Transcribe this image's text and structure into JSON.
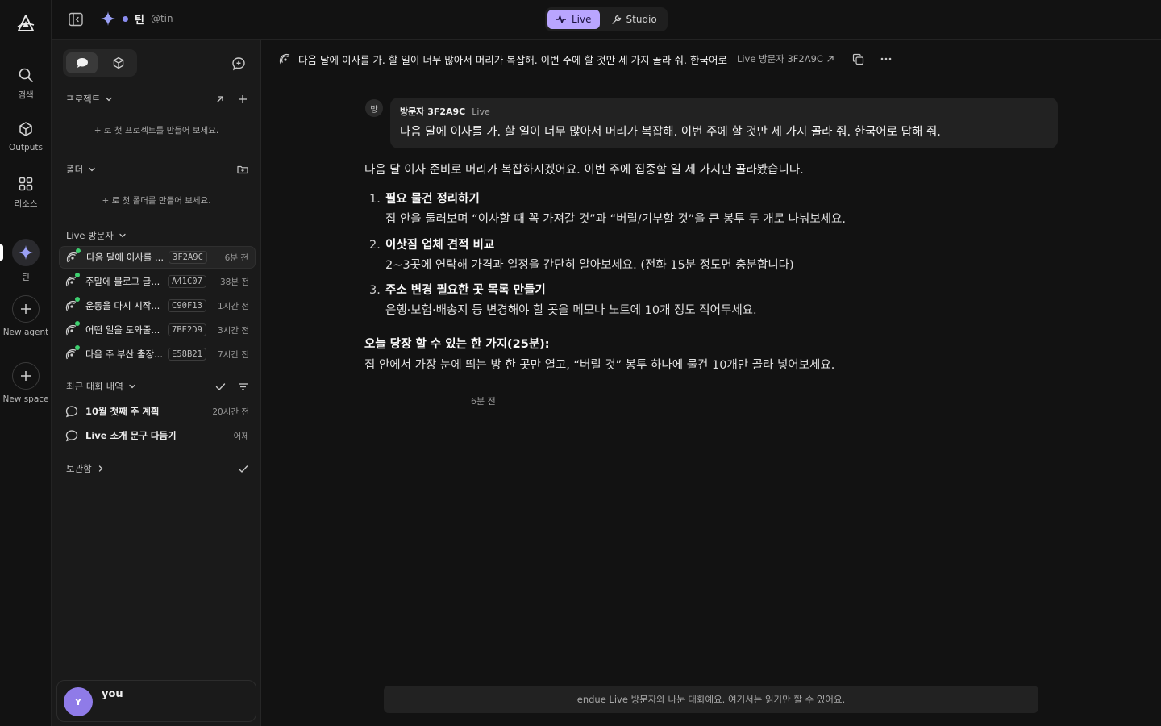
{
  "rail": {
    "items": [
      {
        "label": "검색",
        "icon": "search-icon"
      },
      {
        "label": "Outputs",
        "icon": "cube-icon"
      },
      {
        "label": "리소스",
        "icon": "grid-icon"
      },
      {
        "label": "틴",
        "icon": "diamond-icon"
      },
      {
        "label": "New agent",
        "icon": "plus-icon"
      },
      {
        "label": "New space",
        "icon": "plus-icon"
      }
    ]
  },
  "topbar": {
    "agent_name": "틴",
    "agent_handle": "@tin",
    "modes": [
      {
        "label": "Live",
        "active": true
      },
      {
        "label": "Studio",
        "active": false
      }
    ]
  },
  "sidebar": {
    "projects": {
      "title": "프로젝트",
      "empty_hint": "+ 로 첫 프로젝트를 만들어 보세요."
    },
    "folders": {
      "title": "폴더",
      "empty_hint": "+ 로 첫 폴더를 만들어 보세요."
    },
    "live": {
      "title": "Live 방문자",
      "items": [
        {
          "title": "다음 달에 이사를 ...",
          "code": "3F2A9C",
          "time": "6분 전",
          "active": true
        },
        {
          "title": "주말에 블로그 글...",
          "code": "A41C07",
          "time": "38분 전",
          "active": false
        },
        {
          "title": "운동을 다시 시작...",
          "code": "C90F13",
          "time": "1시간 전",
          "active": false
        },
        {
          "title": "어떤 일을 도와줄...",
          "code": "7BE2D9",
          "time": "3시간 전",
          "active": false
        },
        {
          "title": "다음 주 부산 출장...",
          "code": "E58B21",
          "time": "7시간 전",
          "active": false
        }
      ]
    },
    "history": {
      "title": "최근 대화 내역",
      "items": [
        {
          "title": "10월 첫째 주 계획",
          "time": "20시간 전"
        },
        {
          "title": "Live 소개 문구 다듬기",
          "time": "어제"
        }
      ]
    },
    "archive": {
      "title": "보관함"
    },
    "user": {
      "initial": "Y",
      "name": "you"
    }
  },
  "conversation": {
    "title": "다음 달에 이사를 가. 할 일이 너무 많아서 머리가 복잡해. 이번 주에 할 것만 세 가지 골라 줘. 한국어로",
    "visitor": "Live 방문자 3F2A9C",
    "user_message": {
      "avatar": "방",
      "name": "방문자 3F2A9C",
      "tag": "Live",
      "text": "다음 달에 이사를 가. 할 일이 너무 많아서 머리가 복잡해. 이번 주에 할 것만 세 가지 골라 줘. 한국어로 답해 줘."
    },
    "answer": {
      "intro": "다음 달 이사 준비로 머리가 복잡하시겠어요. 이번 주에 집중할 일 세 가지만 골라봤습니다.",
      "steps": [
        {
          "num": "1.",
          "title": "필요 물건 정리하기",
          "desc": "집 안을 둘러보며 “이사할 때 꼭 가져갈 것”과 “버릴/기부할 것”을 큰 봉투 두 개로 나눠보세요."
        },
        {
          "num": "2.",
          "title": "이삿짐 업체 견적 비교",
          "desc": "2~3곳에 연락해 가격과 일정을 간단히 알아보세요. (전화 15분 정도면 충분합니다)"
        },
        {
          "num": "3.",
          "title": "주소 변경 필요한 곳 목록 만들기",
          "desc": "은행·보험·배송지 등 변경해야 할 곳을 메모나 노트에 10개 정도 적어두세요."
        }
      ],
      "today_title": "오늘 당장 할 수 있는 한 가지(25분):",
      "today_desc": "집 안에서 가장 눈에 띄는 방 한 곳만 열고, “버릴 것” 봉투 하나에 물건 10개만 골라 넣어보세요.",
      "time": "6분 전"
    },
    "readonly_notice": "endue Live 방문자와 나눈 대화예요. 여기서는 읽기만 할 수 있어요."
  },
  "colors": {
    "accent": "#b9a5ff",
    "agent_diamond": "#8a8cf0",
    "live_dot": "#3fd070",
    "avatar": "#8f7be8"
  }
}
